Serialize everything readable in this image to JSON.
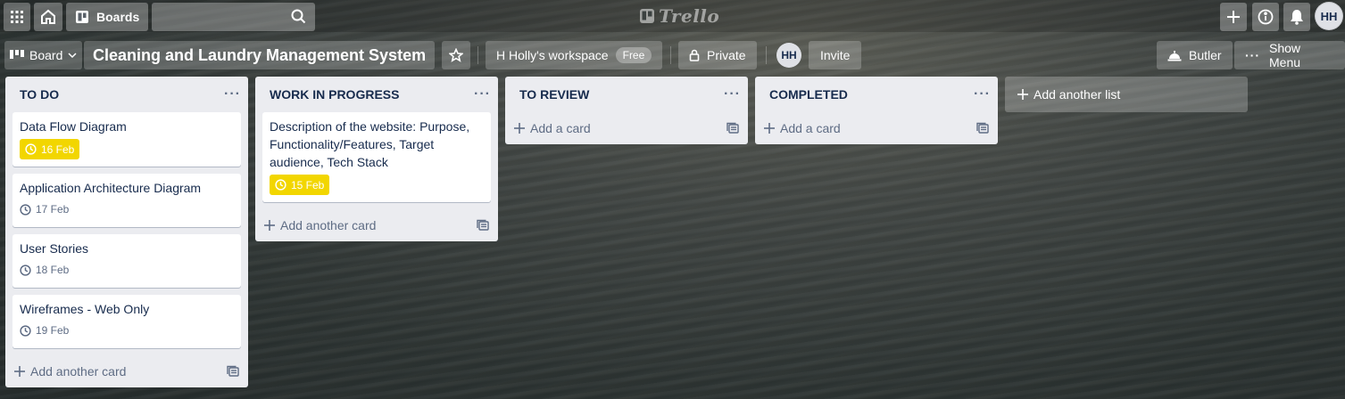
{
  "topbar": {
    "boards_label": "Boards",
    "search_placeholder": "",
    "logo_text": "Trello",
    "user_initials": "HH"
  },
  "board_header": {
    "view_label": "Board",
    "title": "Cleaning and Laundry Management System",
    "workspace_label": "H Holly's workspace",
    "workspace_badge": "Free",
    "visibility_label": "Private",
    "member_initials": "HH",
    "invite_label": "Invite",
    "butler_label": "Butler",
    "show_menu_label": "Show Menu"
  },
  "lists": [
    {
      "title": "TO DO",
      "cards": [
        {
          "title": "Data Flow Diagram",
          "due": "16 Feb",
          "due_highlight": true
        },
        {
          "title": "Application Architecture Diagram",
          "due": "17 Feb",
          "due_highlight": false
        },
        {
          "title": "User Stories",
          "due": "18 Feb",
          "due_highlight": false
        },
        {
          "title": "Wireframes - Web Only",
          "due": "19 Feb",
          "due_highlight": false
        }
      ],
      "add_label": "Add another card"
    },
    {
      "title": "WORK IN PROGRESS",
      "cards": [
        {
          "title": "Description of the website: Purpose, Functionality/Features, Target audience, Tech Stack",
          "due": "15 Feb",
          "due_highlight": true
        }
      ],
      "add_label": "Add another card"
    },
    {
      "title": "TO REVIEW",
      "cards": [],
      "add_label": "Add a card"
    },
    {
      "title": "COMPLETED",
      "cards": [],
      "add_label": "Add a card"
    }
  ],
  "add_list_label": "Add another list",
  "colors": {
    "due_highlight": "#f2d600",
    "list_bg": "#ebecf0",
    "text": "#172b4d"
  }
}
